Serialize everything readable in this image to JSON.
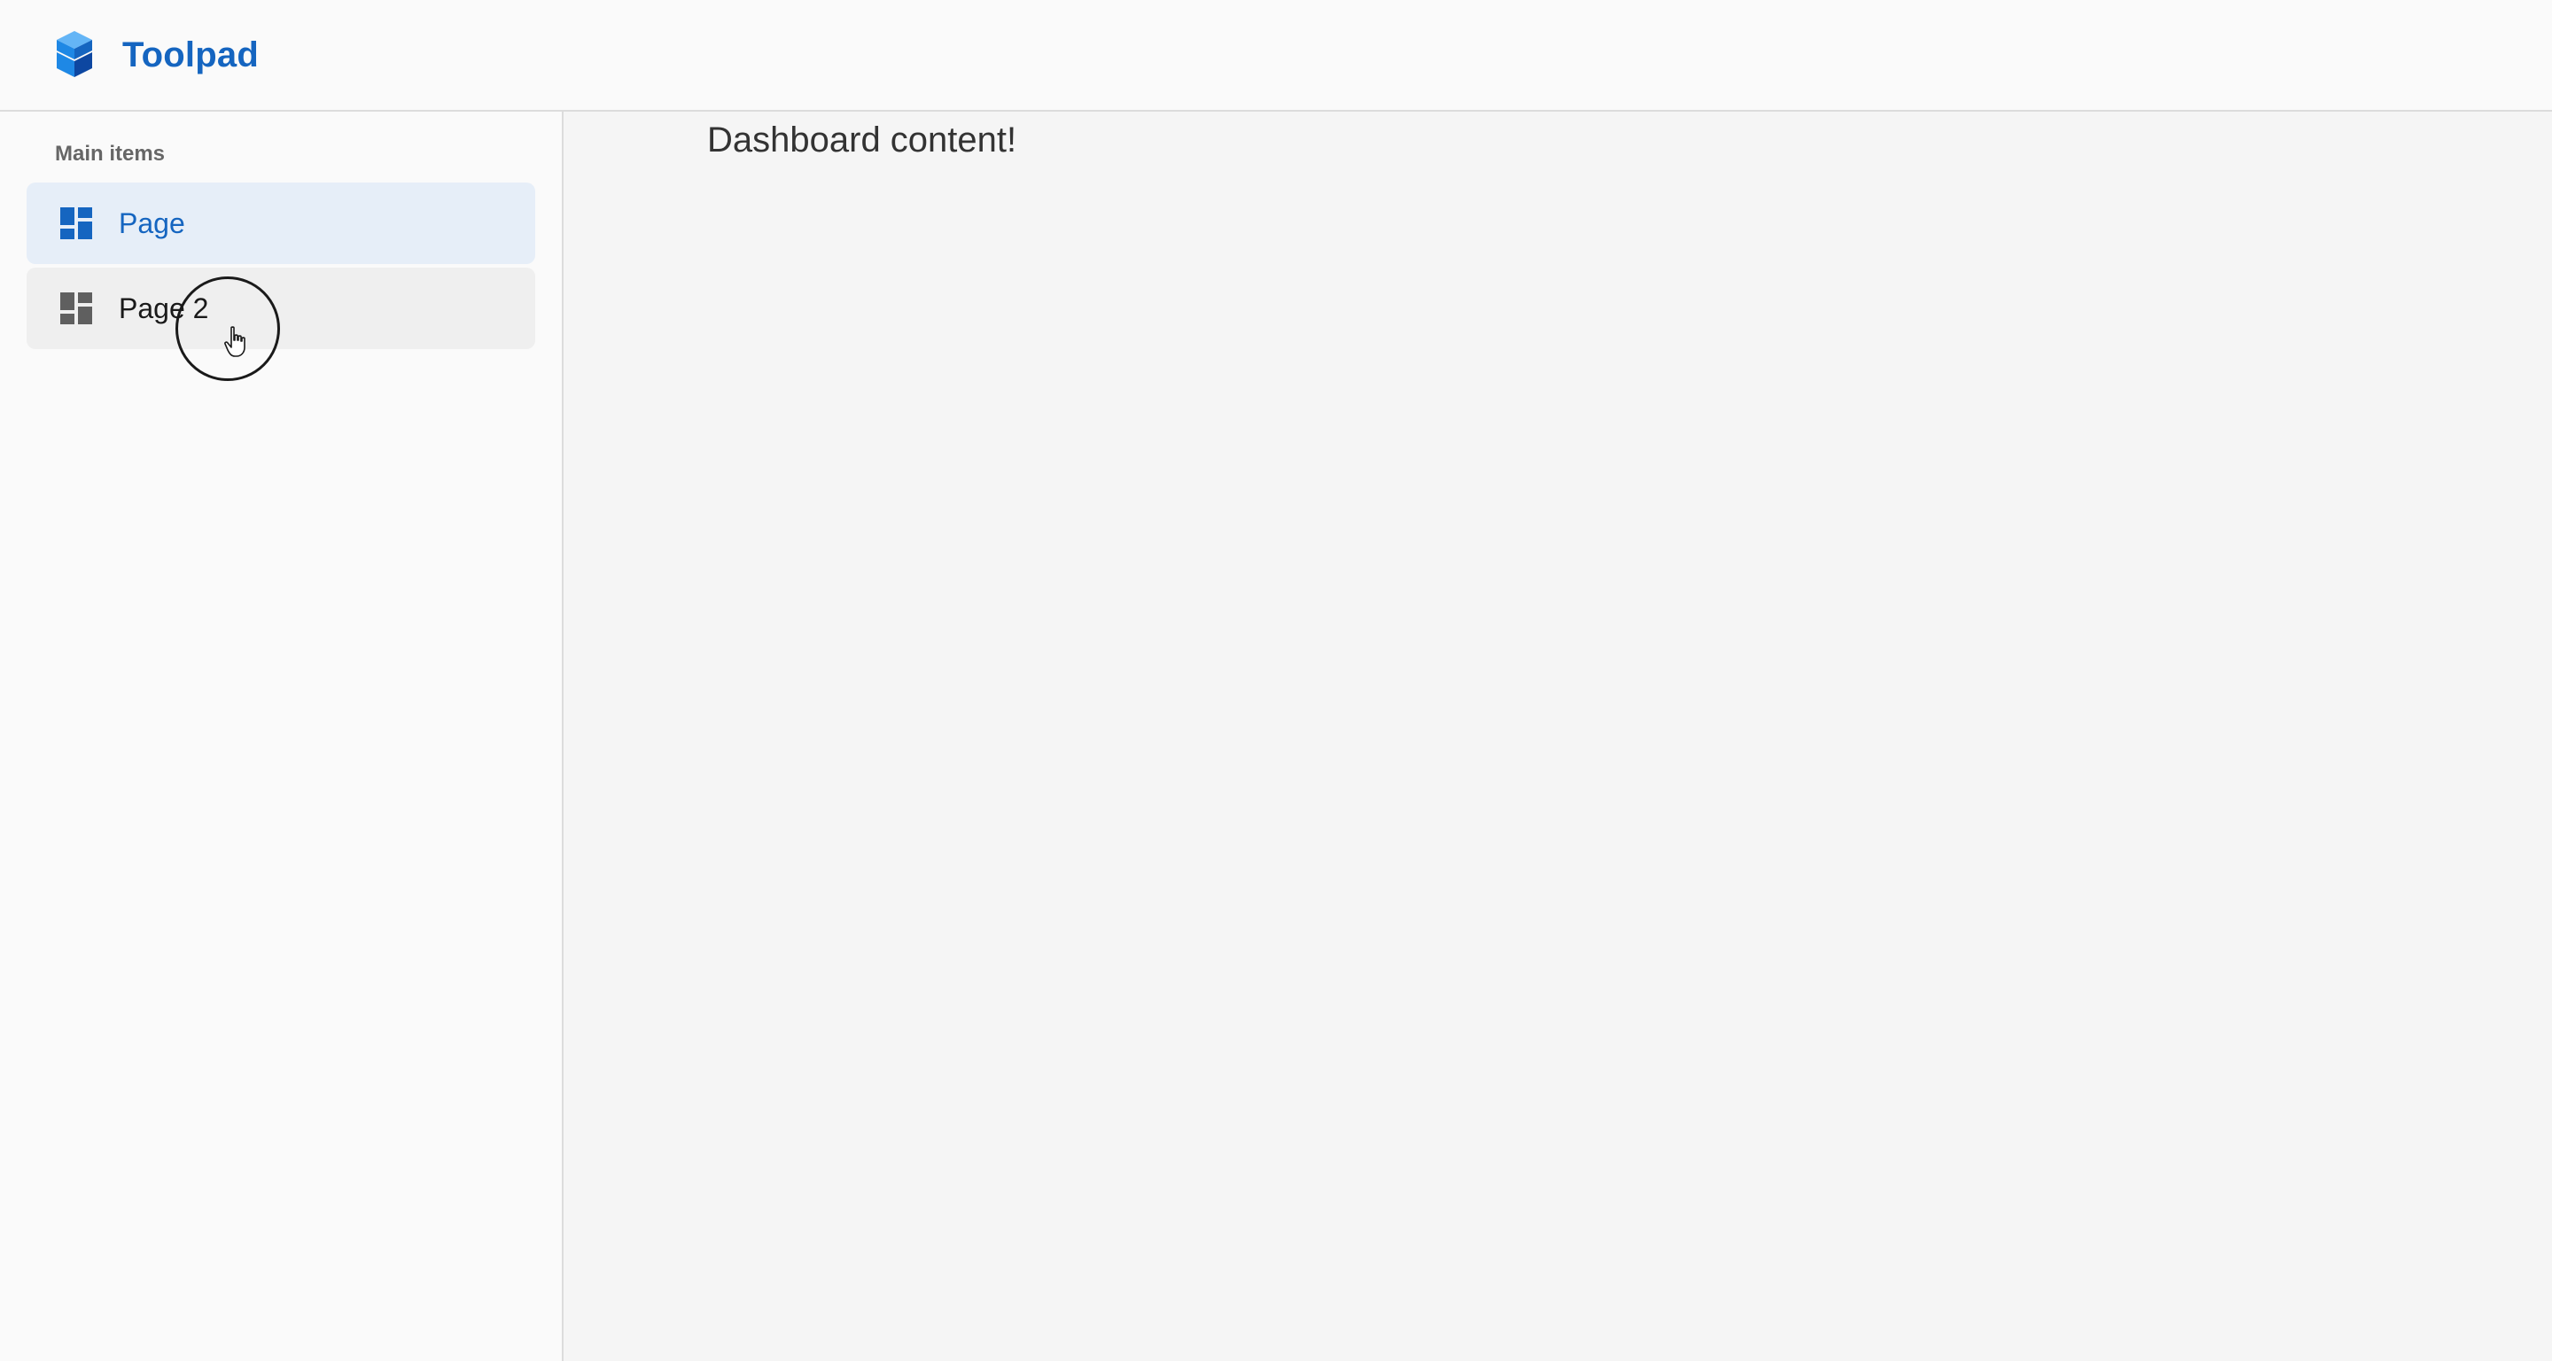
{
  "app": {
    "title": "Toolpad",
    "accent_color": "#1565c0",
    "logo_icon": "toolpad-logo-icon"
  },
  "sidebar": {
    "section_label": "Main items",
    "items": [
      {
        "label": "Page",
        "icon": "dashboard-icon",
        "selected": true,
        "color": "#1565c0",
        "background": "#e6eef8"
      },
      {
        "label": "Page 2",
        "icon": "dashboard-icon",
        "selected": false,
        "hovered": true,
        "color": "#1a1a1a",
        "background": "#efefef"
      }
    ]
  },
  "main": {
    "content_text": "Dashboard content!"
  },
  "cursor": {
    "icon": "hand-pointer-icon"
  }
}
